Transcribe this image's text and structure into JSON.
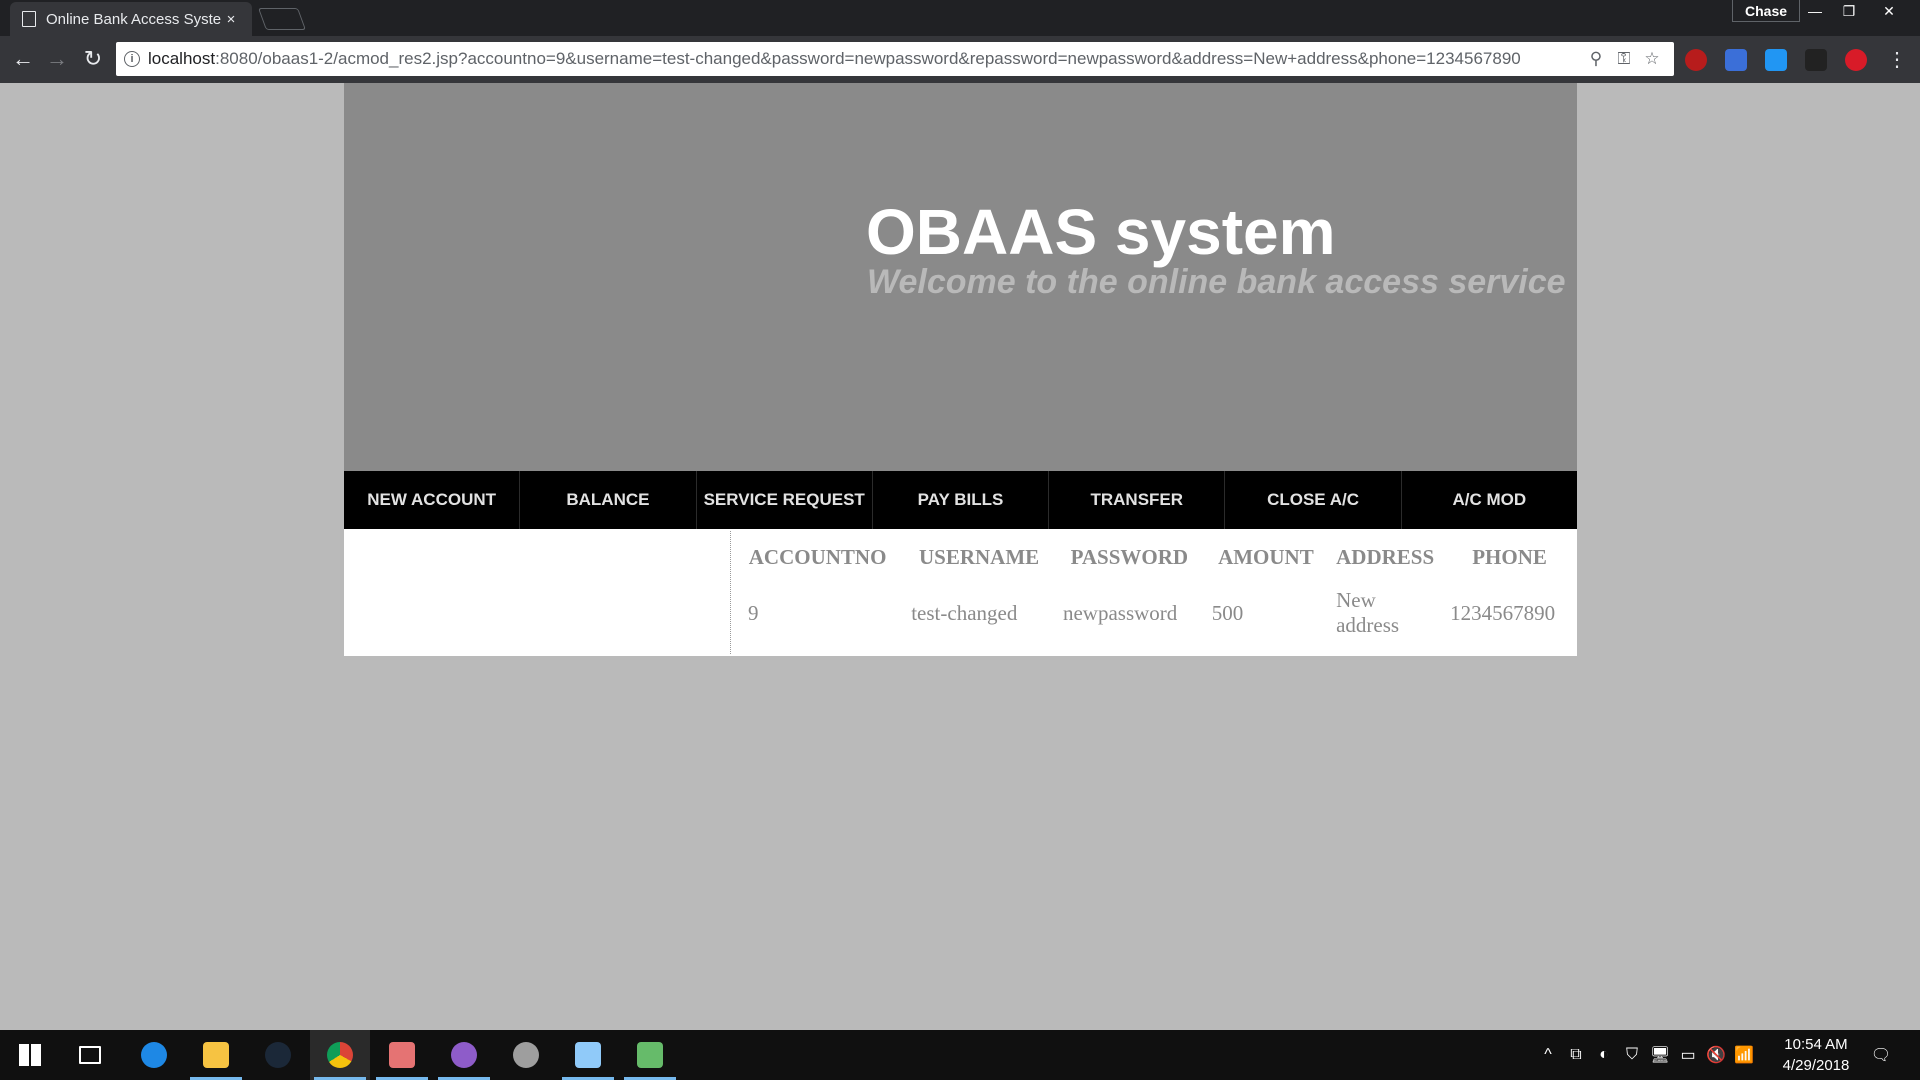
{
  "browser": {
    "tab_title": "Online Bank Access Syste",
    "tab_close": "×",
    "profile_name": "Chase",
    "window_controls": [
      "—",
      "❐",
      "✕"
    ],
    "url_host": "localhost",
    "url_rest": ":8080/obaas1-2/acmod_res2.jsp?accountno=9&username=test-changed&password=newpassword&repassword=newpassword&address=New+address&phone=1234567890",
    "nav": {
      "back": "←",
      "forward": "→",
      "reload": "↻"
    },
    "omnibox_icons": {
      "zoom": "⚲",
      "key": "⚿",
      "star": "☆"
    },
    "menu_icon": "⋮",
    "extensions": [
      {
        "name": "ublock-icon",
        "color": "#b71c1c"
      },
      {
        "name": "extension-blue-icon",
        "color": "#3b6fd8"
      },
      {
        "name": "extension-lightblue-icon",
        "color": "#2196f3"
      },
      {
        "name": "extension-dark-icon",
        "color": "#222222"
      },
      {
        "name": "extension-red-icon",
        "color": "#d81b28"
      }
    ]
  },
  "page": {
    "title": "OBAAS system",
    "subtitle": "Welcome to the online bank access service",
    "menu": [
      "NEW ACCOUNT",
      "BALANCE",
      "SERVICE REQUEST",
      "PAY BILLS",
      "TRANSFER",
      "CLOSE A/C",
      "A/C MOD"
    ],
    "table": {
      "headers": [
        "ACCOUNTNO",
        "USERNAME",
        "PASSWORD",
        "AMOUNT",
        "ADDRESS",
        "PHONE"
      ],
      "rows": [
        [
          "9",
          "test-changed",
          "newpassword",
          "500",
          "New address",
          "1234567890"
        ]
      ]
    }
  },
  "taskbar": {
    "apps": [
      {
        "name": "start-icon",
        "color": "#ffffff"
      },
      {
        "name": "task-view-icon",
        "color": "#ffffff"
      },
      {
        "name": "edge-icon",
        "color": "#1e88e5"
      },
      {
        "name": "file-explorer-icon",
        "color": "#f6c342"
      },
      {
        "name": "steam-icon",
        "color": "#1b2838"
      },
      {
        "name": "chrome-icon",
        "color": "#4caf50"
      },
      {
        "name": "snipping-icon",
        "color": "#e57373"
      },
      {
        "name": "github-desktop-icon",
        "color": "#8e5cc9"
      },
      {
        "name": "settings-icon",
        "color": "#9e9e9e"
      },
      {
        "name": "photos-icon",
        "color": "#90caf9"
      },
      {
        "name": "media-icon",
        "color": "#66bb6a"
      }
    ],
    "tray_icons": [
      "^",
      "⧉",
      "◐",
      "⛉",
      "🖥",
      "▭",
      "🔇",
      "📶"
    ],
    "time": "10:54 AM",
    "date": "4/29/2018",
    "notification_icon": "🗨"
  }
}
